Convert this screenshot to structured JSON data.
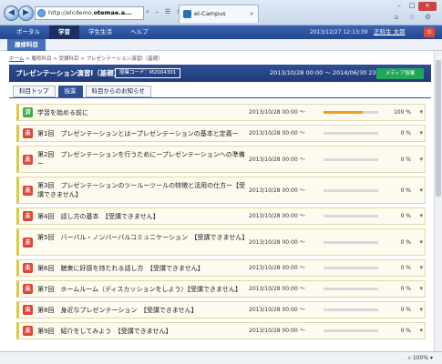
{
  "browser": {
    "address_prefix": "http://elcdemo.",
    "address_host": "otemae.a...",
    "address_tools": "⌕ ‒ ☰ ×",
    "tab_title": "el-Campus",
    "tab_close": "×",
    "win_min": "–",
    "win_max": "□",
    "win_close": "×",
    "tool_icons": "⌂ ☆ ⚙",
    "back": "◀",
    "forward": "▶",
    "zoom": "⌕ 100% ▾"
  },
  "appbar": {
    "menu": [
      "ポータル",
      "学習",
      "学生生活",
      "ヘルプ"
    ],
    "datetime": "2013/12/27 12:13:39",
    "user": "正科生 太郎"
  },
  "subnav": {
    "label": "履修科目"
  },
  "breadcrumb": {
    "home": "ホーム",
    "rest": " > 履修科目 > 受講科目 > プレゼンテーション演習Ⅰ（基礎）"
  },
  "course": {
    "title": "プレゼンテーション演習Ⅰ（基礎）",
    "code": "授業コード：M2004301",
    "period": "2013/10/28 00:00 ～ 2014/06/30 23:59",
    "media_button": "メディア授業"
  },
  "tabs": [
    "科目トップ",
    "授業",
    "科目からのお知らせ"
  ],
  "lessons": [
    {
      "badge": "済",
      "label": "学習を始める前に",
      "date": "2013/10/28 00:00 ～",
      "pct": "100 %",
      "progress": 0.72
    },
    {
      "badge": "未",
      "label": "第1回　プレゼンテーションとはープレゼンテーションの基本と定義ー",
      "date": "2013/10/28 00:00 ～",
      "pct": "0 %",
      "progress": 0
    },
    {
      "badge": "未",
      "label": "第2回　プレゼンテーションを行うためにープレゼンテーションへの準備ー",
      "date": "2013/10/28 00:00 ～",
      "pct": "0 %",
      "progress": 0
    },
    {
      "badge": "未",
      "label": "第3回　プレゼンテーションのツールーツールの特徴と活用の仕方ー【受講できません】",
      "date": "2013/10/28 00:00 ～",
      "pct": "0 %",
      "progress": 0
    },
    {
      "badge": "未",
      "label": "第4回　話し方の基本　【受講できません】",
      "date": "2013/10/28 00:00 ～",
      "pct": "0 %",
      "progress": 0
    },
    {
      "badge": "未",
      "label": "第5回　バーバル・ノンバーバルコミュニケーション　【受講できません】",
      "date": "2013/10/28 00:00 ～",
      "pct": "0 %",
      "progress": 0
    },
    {
      "badge": "未",
      "label": "第6回　聴衆に好感を持たれる話し方　【受講できません】",
      "date": "2013/10/28 00:00 ～",
      "pct": "0 %",
      "progress": 0
    },
    {
      "badge": "未",
      "label": "第7回　ホームルーム（ディスカッションをしよう）【受講できません】",
      "date": "2013/10/28 00:00 ～",
      "pct": "0 %",
      "progress": 0
    },
    {
      "badge": "未",
      "label": "第8回　身近なプレゼンテーション　【受講できません】",
      "date": "2013/10/28 00:00 ～",
      "pct": "0 %",
      "progress": 0
    },
    {
      "badge": "未",
      "label": "第9回　紹介をしてみよう　【受講できません】",
      "date": "2013/10/28 00:00 ～",
      "pct": "0 %",
      "progress": 0
    }
  ],
  "colors": {
    "appbar": "#24478f",
    "course_header": "#2f4f95",
    "done_badge": "#46a84a",
    "not_badge": "#e0433a",
    "progress_fill": "#f0a018",
    "media_button": "#1ea85a"
  }
}
